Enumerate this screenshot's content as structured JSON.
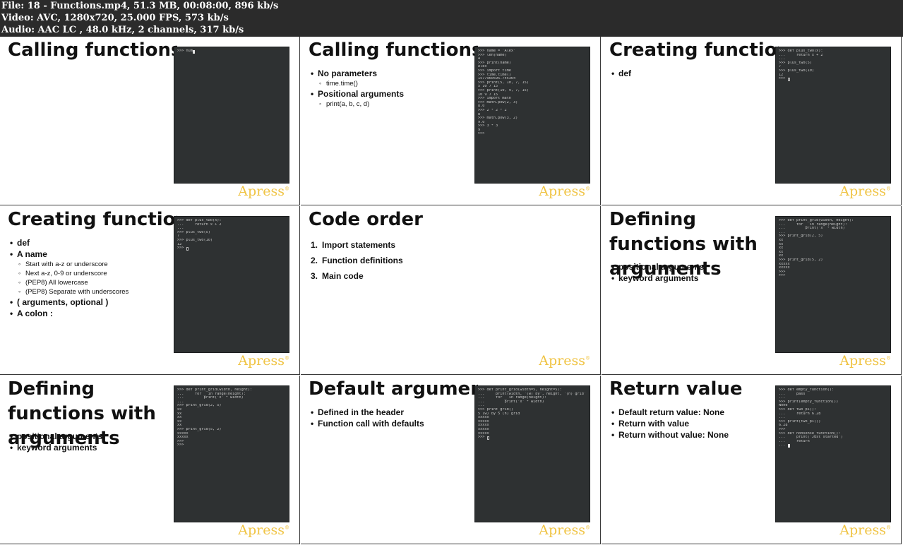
{
  "header": {
    "file": "File: 18 - Functions.mp4, 51.3 MB, 00:08:00, 896 kb/s",
    "video": "Video: AVC, 1280x720, 25.000 FPS, 573 kb/s",
    "audio": "Audio: AAC LC , 48.0 kHz, 2 channels, 317 kb/s"
  },
  "logo": "Apress",
  "logo_mark": "®",
  "colors": {
    "logo": "#f0c445",
    "terminal_bg": "#2e3132",
    "header_bg": "#2b2b2b"
  },
  "tiles": [
    {
      "title": "Calling functions",
      "content": [],
      "terminal": [
        ">>> num"
      ],
      "cursor": "solid"
    },
    {
      "title": "Calling functions",
      "content": [
        {
          "t": "item",
          "text": "No parameters"
        },
        {
          "t": "sub",
          "text": "time.time()"
        },
        {
          "t": "item",
          "text": "Positional arguments"
        },
        {
          "t": "sub",
          "text": "print(a, b, c, d)"
        }
      ],
      "terminal": [
        ">>> name = 'Alex'",
        ">>> len(name)",
        "4",
        ">>> print(name)",
        "Alex",
        ">>> import time",
        ">>> time.time()",
        "1577960595.745364",
        ">>> print(5, 10, 7, 15)",
        "5 10 7 15",
        ">>> print(10, 9, 7, 15)",
        "10 9 7 15",
        ">>> import math",
        ">>> math.pow(2, 3)",
        "8.0",
        ">>> 2 * 2 * 2",
        "8",
        ">>> math.pow(3, 2)",
        "9.0",
        ">>> 3 * 3",
        "9",
        ">>>"
      ],
      "cursor": "none"
    },
    {
      "title": "Creating functions",
      "content": [
        {
          "t": "item",
          "text": "def"
        }
      ],
      "terminal": [
        ">>> def plus_two(x):",
        "...     return x + 2",
        "...",
        ">>> plus_two(5)",
        "7",
        ">>> plus_two(10)",
        "12",
        ">>> "
      ],
      "cursor": "hollow"
    },
    {
      "title": "Creating functions",
      "content": [
        {
          "t": "item",
          "text": "def"
        },
        {
          "t": "item",
          "text": "A name"
        },
        {
          "t": "sub",
          "text": "Start with a-z or underscore"
        },
        {
          "t": "sub",
          "text": "Next a-z, 0-9 or underscore"
        },
        {
          "t": "sub",
          "text": "(PEP8) All lowercase"
        },
        {
          "t": "sub",
          "text": "(PEP8) Separate with underscores"
        },
        {
          "t": "item",
          "text": "( arguments, optional )"
        },
        {
          "t": "item",
          "text": "A colon :"
        }
      ],
      "terminal": [
        ">>> def plus_two(x):",
        "...     return x + 2",
        "...",
        ">>> plus_two(5)",
        "7",
        ">>> plus_two(10)",
        "12",
        ">>> "
      ],
      "cursor": "hollow"
    },
    {
      "title": "Code order",
      "content": [
        {
          "t": "num",
          "n": "1.",
          "text": "Import statements"
        },
        {
          "t": "num",
          "n": "2.",
          "text": "Function definitions"
        },
        {
          "t": "num",
          "n": "3.",
          "text": "Main code"
        }
      ],
      "terminal": null,
      "cursor": "none"
    },
    {
      "title": "Defining functions with arguments",
      "content": [
        {
          "t": "item",
          "text": "positional arguments"
        },
        {
          "t": "item",
          "text": "keyword arguments"
        }
      ],
      "terminal": [
        ">>> def print_grid(width, height):",
        "...     for _ in range(height):",
        "...         print('x' * width)",
        "...",
        ">>> print_grid(2, 5)",
        "xx",
        "xx",
        "xx",
        "xx",
        "xx",
        ">>> print_grid(5, 2)",
        "xxxxx",
        "xxxxx",
        ">>>",
        ">>>"
      ],
      "cursor": "none"
    },
    {
      "title": "Defining functions with arguments",
      "content": [
        {
          "t": "item",
          "text": "positional arguments"
        },
        {
          "t": "item",
          "text": "keyword arguments"
        }
      ],
      "terminal": [
        ">>> def print_grid(width, height):",
        "...     for _ in range(height):",
        "...         print('x' * width)",
        "...",
        ">>> print_grid(2, 5)",
        "xx",
        "xx",
        "xx",
        "xx",
        "xx",
        ">>> print_grid(5, 2)",
        "xxxxx",
        "xxxxx",
        ">>>",
        ">>>"
      ],
      "cursor": "none"
    },
    {
      "title": "Default arguments",
      "content": [
        {
          "t": "item",
          "text": "Defined in the header"
        },
        {
          "t": "item",
          "text": "Function call with defaults"
        }
      ],
      "terminal": [
        ">>> def print_grid(width=5, height=5):",
        "...     print(width, '(w) by', height, '(h) grid')",
        "...     for _ in range(height):",
        "...         print('x' * width)",
        "...",
        ">>> print_grid()",
        "5 (w) by 5 (h) grid",
        "xxxxx",
        "xxxxx",
        "xxxxx",
        "xxxxx",
        "xxxxx",
        ">>> "
      ],
      "cursor": "hollow"
    },
    {
      "title": "Return value",
      "content": [
        {
          "t": "item",
          "text": "Default return value: None"
        },
        {
          "t": "item",
          "text": "Return with value"
        },
        {
          "t": "item",
          "text": "Return without value: None"
        }
      ],
      "terminal": [
        ">>> def empty_function():",
        "...     pass",
        "...",
        ">>> print(empty_function())",
        "None",
        ">>> def two_pi():",
        "...     return 6.28",
        "...",
        ">>> print(two_pi())",
        "6.28",
        ">>>",
        ">>> def nonsense_function():",
        "...     print('Just started')",
        "...     return",
        "... "
      ],
      "cursor": "solid"
    }
  ]
}
